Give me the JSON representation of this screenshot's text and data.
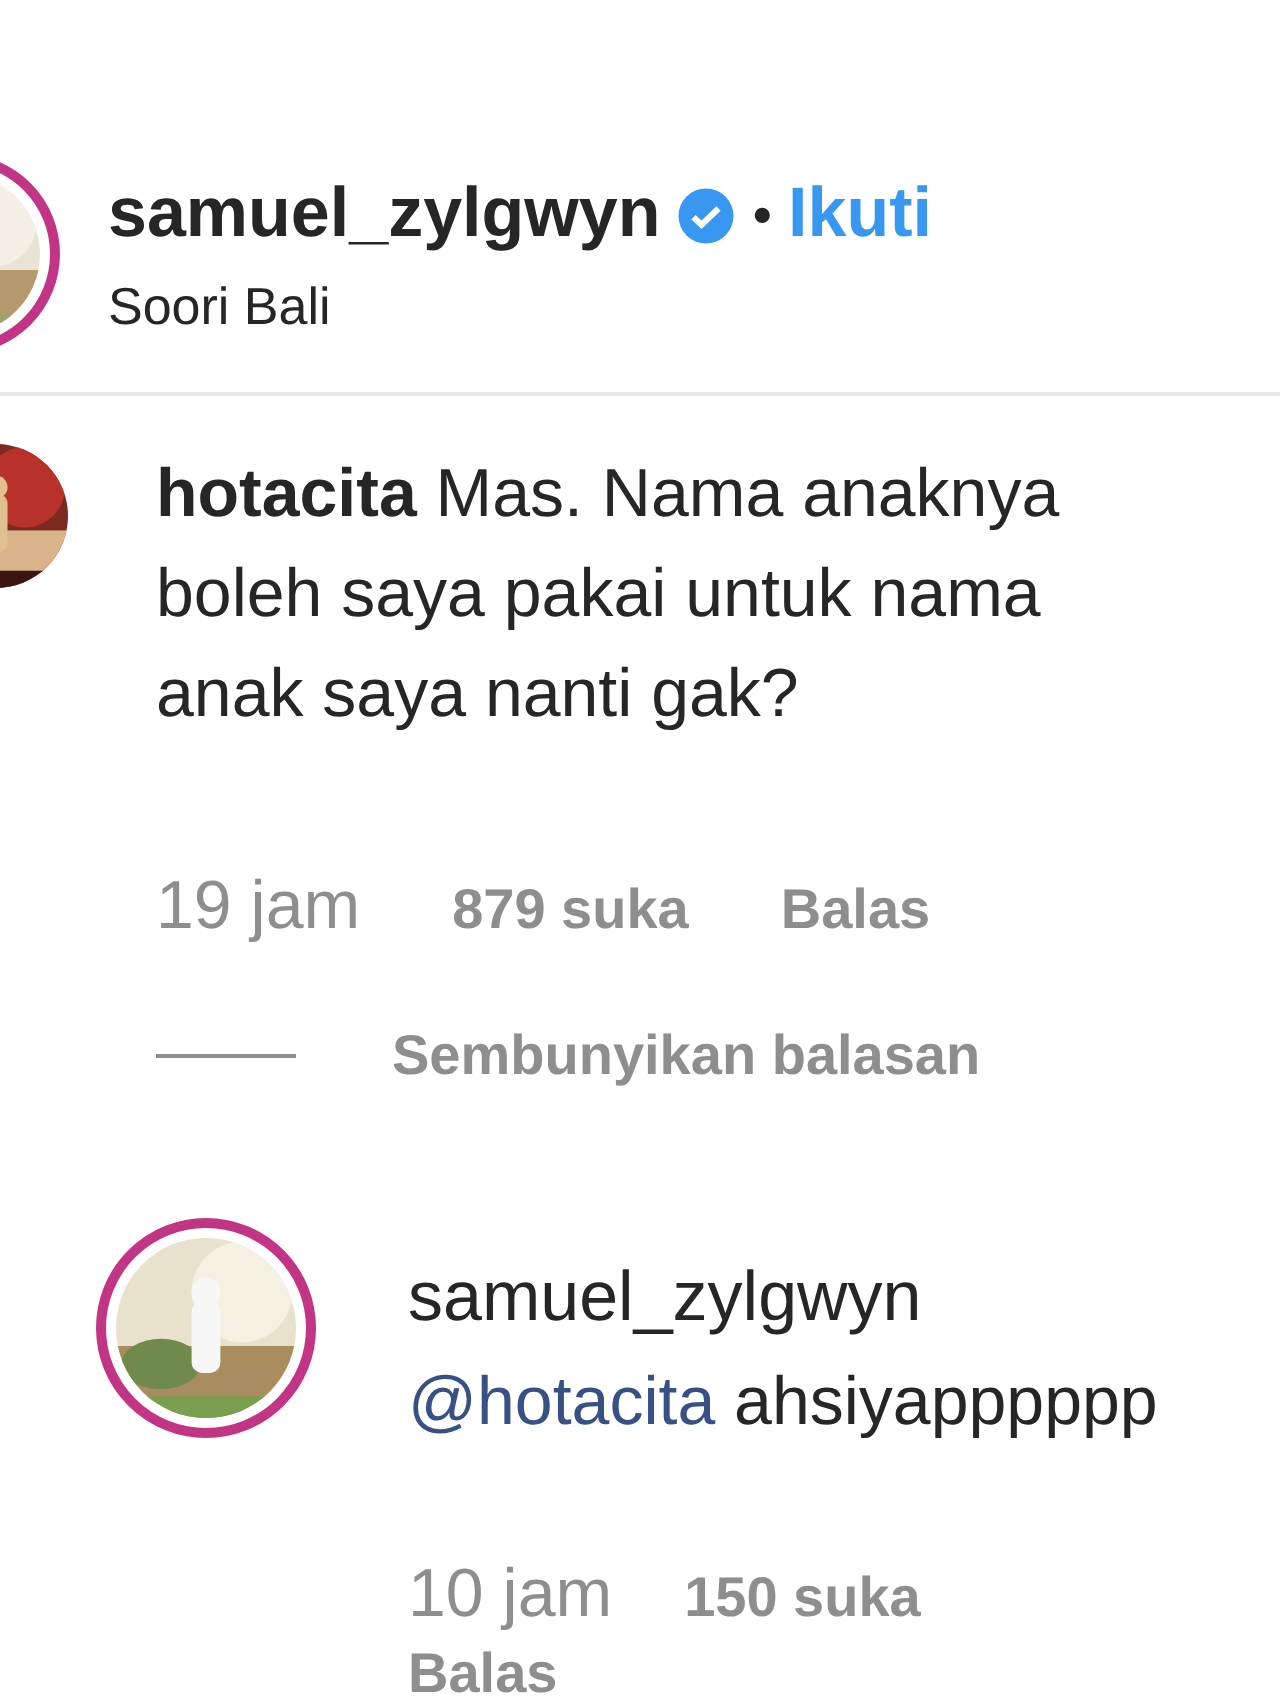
{
  "post_header": {
    "username": "samuel_zylgwyn",
    "verified": true,
    "separator": "•",
    "follow_label": "Ikuti",
    "location": "Soori Bali"
  },
  "comment": {
    "username": "hotacita",
    "text": "Mas. Nama anaknya boleh saya pakai untuk nama anak saya nanti gak?",
    "time": "19 jam",
    "likes": "879 suka",
    "reply_label": "Balas",
    "hide_replies_label": "Sembunyikan balasan"
  },
  "reply": {
    "username": "samuel_zylgwyn",
    "mention": "@hotacita",
    "text": "ahsiyapppppp",
    "time": "10 jam",
    "likes": "150 suka",
    "reply_label": "Balas"
  }
}
